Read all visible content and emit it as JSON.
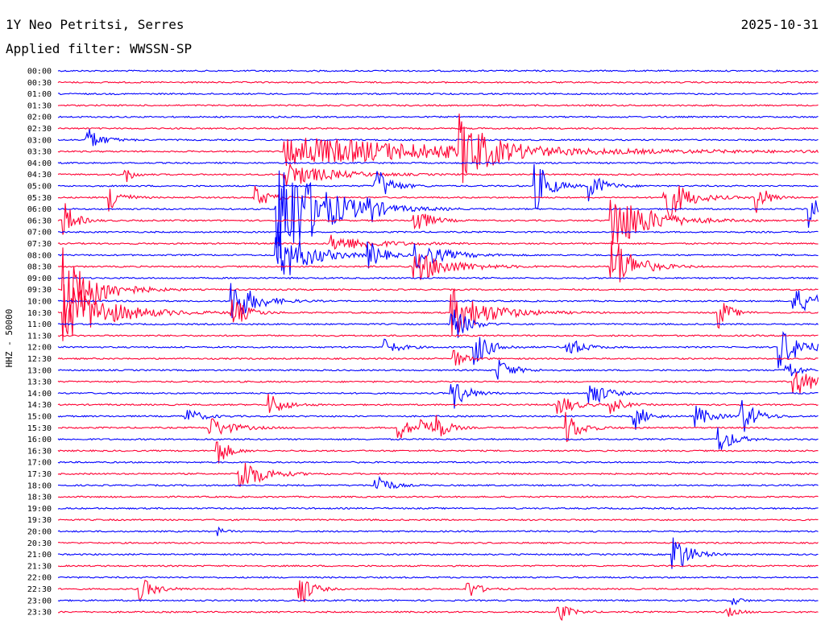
{
  "header": {
    "station": "1Y Neo Petritsi, Serres",
    "filter": "Applied filter: WWSSN-SP",
    "date": "2025-10-31"
  },
  "chart_data": {
    "type": "line",
    "subtype": "helicorder",
    "title": "1Y Neo Petritsi, Serres",
    "subtitle": "Applied filter: WWSSN-SP",
    "date": "2025-10-31",
    "ylabel": "HHZ - 50000",
    "xlabel": "",
    "trace_colors": [
      "#0000ff",
      "#ff0033"
    ],
    "row_labels": [
      "00:00",
      "00:30",
      "01:00",
      "01:30",
      "02:00",
      "02:30",
      "03:00",
      "03:30",
      "04:00",
      "04:30",
      "05:00",
      "05:30",
      "06:00",
      "06:30",
      "07:00",
      "07:30",
      "08:00",
      "08:30",
      "09:00",
      "09:30",
      "10:00",
      "10:30",
      "11:00",
      "11:30",
      "12:00",
      "12:30",
      "13:00",
      "13:30",
      "14:00",
      "14:30",
      "15:00",
      "15:30",
      "16:00",
      "16:30",
      "17:00",
      "17:30",
      "18:00",
      "18:30",
      "19:00",
      "19:30",
      "20:00",
      "20:30",
      "21:00",
      "21:30",
      "22:00",
      "22:30",
      "23:00",
      "23:30"
    ],
    "events": [
      {
        "row": 6,
        "t": 0.04,
        "amp": 14,
        "dur": 0.02
      },
      {
        "row": 7,
        "t": 0.3,
        "amp": 20,
        "dur": 0.25
      },
      {
        "row": 7,
        "t": 0.53,
        "amp": 40,
        "dur": 0.04
      },
      {
        "row": 9,
        "t": 0.09,
        "amp": 10,
        "dur": 0.01
      },
      {
        "row": 9,
        "t": 0.3,
        "amp": 16,
        "dur": 0.06
      },
      {
        "row": 10,
        "t": 0.42,
        "amp": 22,
        "dur": 0.02
      },
      {
        "row": 10,
        "t": 0.63,
        "amp": 30,
        "dur": 0.02
      },
      {
        "row": 10,
        "t": 0.7,
        "amp": 18,
        "dur": 0.02
      },
      {
        "row": 11,
        "t": 0.07,
        "amp": 18,
        "dur": 0.015
      },
      {
        "row": 11,
        "t": 0.26,
        "amp": 14,
        "dur": 0.02
      },
      {
        "row": 11,
        "t": 0.8,
        "amp": 30,
        "dur": 0.03
      },
      {
        "row": 11,
        "t": 0.92,
        "amp": 20,
        "dur": 0.015
      },
      {
        "row": 12,
        "t": 0.29,
        "amp": 80,
        "dur": 0.06
      },
      {
        "row": 12,
        "t": 0.41,
        "amp": 14,
        "dur": 0.01
      },
      {
        "row": 12,
        "t": 0.99,
        "amp": 30,
        "dur": 0.01
      },
      {
        "row": 13,
        "t": 0.01,
        "amp": 22,
        "dur": 0.015
      },
      {
        "row": 13,
        "t": 0.47,
        "amp": 18,
        "dur": 0.02
      },
      {
        "row": 13,
        "t": 0.73,
        "amp": 40,
        "dur": 0.05
      },
      {
        "row": 15,
        "t": 0.36,
        "amp": 10,
        "dur": 0.06
      },
      {
        "row": 16,
        "t": 0.29,
        "amp": 40,
        "dur": 0.04
      },
      {
        "row": 16,
        "t": 0.41,
        "amp": 16,
        "dur": 0.02
      },
      {
        "row": 16,
        "t": 0.47,
        "amp": 18,
        "dur": 0.04
      },
      {
        "row": 17,
        "t": 0.47,
        "amp": 20,
        "dur": 0.05
      },
      {
        "row": 17,
        "t": 0.73,
        "amp": 40,
        "dur": 0.03
      },
      {
        "row": 19,
        "t": 0.01,
        "amp": 60,
        "dur": 0.04
      },
      {
        "row": 20,
        "t": 0.23,
        "amp": 30,
        "dur": 0.03
      },
      {
        "row": 20,
        "t": 0.97,
        "amp": 14,
        "dur": 0.05
      },
      {
        "row": 21,
        "t": 0.01,
        "amp": 40,
        "dur": 0.06
      },
      {
        "row": 21,
        "t": 0.23,
        "amp": 20,
        "dur": 0.02
      },
      {
        "row": 21,
        "t": 0.52,
        "amp": 30,
        "dur": 0.05
      },
      {
        "row": 21,
        "t": 0.87,
        "amp": 20,
        "dur": 0.015
      },
      {
        "row": 22,
        "t": 0.52,
        "amp": 24,
        "dur": 0.02
      },
      {
        "row": 24,
        "t": 0.43,
        "amp": 10,
        "dur": 0.02
      },
      {
        "row": 24,
        "t": 0.55,
        "amp": 22,
        "dur": 0.02
      },
      {
        "row": 24,
        "t": 0.67,
        "amp": 14,
        "dur": 0.02
      },
      {
        "row": 24,
        "t": 0.95,
        "amp": 26,
        "dur": 0.03
      },
      {
        "row": 25,
        "t": 0.52,
        "amp": 14,
        "dur": 0.015
      },
      {
        "row": 26,
        "t": 0.58,
        "amp": 14,
        "dur": 0.02
      },
      {
        "row": 26,
        "t": 0.96,
        "amp": 14,
        "dur": 0.015
      },
      {
        "row": 27,
        "t": 0.97,
        "amp": 18,
        "dur": 0.03
      },
      {
        "row": 28,
        "t": 0.7,
        "amp": 20,
        "dur": 0.02
      },
      {
        "row": 28,
        "t": 0.52,
        "amp": 20,
        "dur": 0.02
      },
      {
        "row": 29,
        "t": 0.28,
        "amp": 14,
        "dur": 0.02
      },
      {
        "row": 29,
        "t": 0.66,
        "amp": 14,
        "dur": 0.02
      },
      {
        "row": 29,
        "t": 0.73,
        "amp": 10,
        "dur": 0.015
      },
      {
        "row": 30,
        "t": 0.17,
        "amp": 10,
        "dur": 0.02
      },
      {
        "row": 30,
        "t": 0.76,
        "amp": 16,
        "dur": 0.015
      },
      {
        "row": 30,
        "t": 0.84,
        "amp": 14,
        "dur": 0.02
      },
      {
        "row": 30,
        "t": 0.9,
        "amp": 22,
        "dur": 0.02
      },
      {
        "row": 31,
        "t": 0.2,
        "amp": 14,
        "dur": 0.03
      },
      {
        "row": 31,
        "t": 0.45,
        "amp": 14,
        "dur": 0.015
      },
      {
        "row": 31,
        "t": 0.48,
        "amp": 14,
        "dur": 0.015
      },
      {
        "row": 31,
        "t": 0.5,
        "amp": 14,
        "dur": 0.015
      },
      {
        "row": 31,
        "t": 0.67,
        "amp": 20,
        "dur": 0.02
      },
      {
        "row": 32,
        "t": 0.87,
        "amp": 18,
        "dur": 0.02
      },
      {
        "row": 33,
        "t": 0.21,
        "amp": 20,
        "dur": 0.015
      },
      {
        "row": 35,
        "t": 0.24,
        "amp": 24,
        "dur": 0.03
      },
      {
        "row": 36,
        "t": 0.42,
        "amp": 18,
        "dur": 0.015
      },
      {
        "row": 40,
        "t": 0.21,
        "amp": 5,
        "dur": 0.01
      },
      {
        "row": 42,
        "t": 0.81,
        "amp": 30,
        "dur": 0.02
      },
      {
        "row": 45,
        "t": 0.11,
        "amp": 14,
        "dur": 0.02
      },
      {
        "row": 45,
        "t": 0.32,
        "amp": 22,
        "dur": 0.015
      },
      {
        "row": 45,
        "t": 0.54,
        "amp": 12,
        "dur": 0.015
      },
      {
        "row": 46,
        "t": 0.89,
        "amp": 5,
        "dur": 0.01
      },
      {
        "row": 47,
        "t": 0.66,
        "amp": 12,
        "dur": 0.015
      },
      {
        "row": 47,
        "t": 0.88,
        "amp": 6,
        "dur": 0.015
      }
    ]
  }
}
